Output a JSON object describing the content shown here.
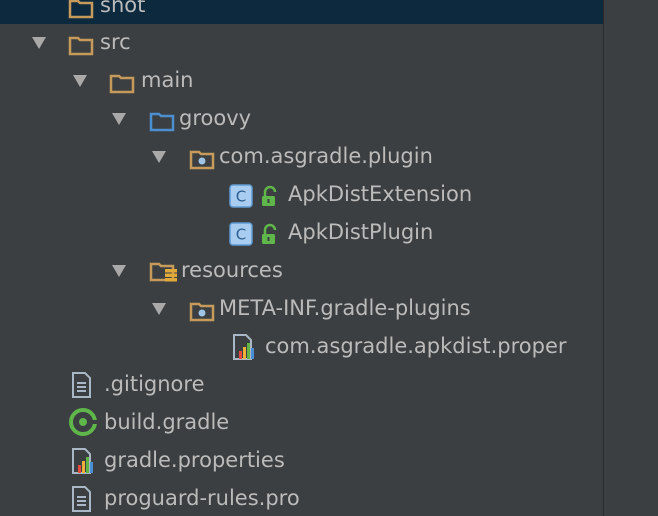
{
  "tree": {
    "items": [
      {
        "label": "shot",
        "icon": "folder-icon"
      },
      {
        "label": "src",
        "icon": "folder-icon"
      },
      {
        "label": "main",
        "icon": "folder-icon"
      },
      {
        "label": "groovy",
        "icon": "source-folder-icon"
      },
      {
        "label": "com.asgradle.plugin",
        "icon": "package-icon"
      },
      {
        "label": "ApkDistExtension",
        "icon": "groovy-class-icon"
      },
      {
        "label": "ApkDistPlugin",
        "icon": "groovy-class-icon"
      },
      {
        "label": "resources",
        "icon": "resources-folder-icon"
      },
      {
        "label": "META-INF.gradle-plugins",
        "icon": "package-icon"
      },
      {
        "label": "com.asgradle.apkdist.proper",
        "icon": "properties-file-icon"
      },
      {
        "label": ".gitignore",
        "icon": "text-file-icon"
      },
      {
        "label": "build.gradle",
        "icon": "gradle-icon"
      },
      {
        "label": "gradle.properties",
        "icon": "properties-file-icon"
      },
      {
        "label": "proguard-rules.pro",
        "icon": "text-file-icon"
      }
    ]
  },
  "colors": {
    "background": "#3c3f41",
    "selection": "#0d293e",
    "text": "#bbbbbb",
    "folder": "#c69a5b",
    "source_folder": "#4b8fd1",
    "class_badge": "#a8cdf0",
    "lock": "#5fb64b"
  }
}
